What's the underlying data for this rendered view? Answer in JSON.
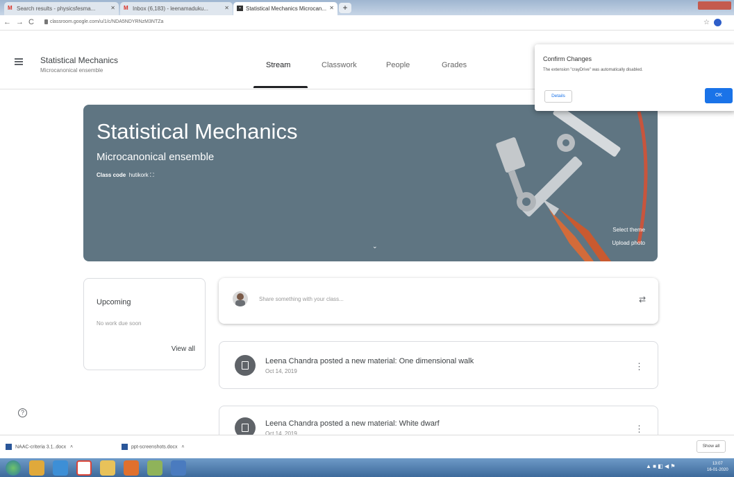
{
  "browser": {
    "tabs": [
      {
        "label": "Search results - physicsfesma...",
        "icon": "gmail-icon"
      },
      {
        "label": "Inbox (6,183) - leenamaduku...",
        "icon": "gmail-icon"
      },
      {
        "label": "Statistical Mechanics Microcan...",
        "icon": "classroom-icon"
      }
    ],
    "new_tab": "+",
    "url": "classroom.google.com/u/1/c/NDA5NDYRNzM3NTZa"
  },
  "header": {
    "class_title": "Statistical Mechanics",
    "class_subtitle": "Microcanonical ensemble",
    "tabs": [
      "Stream",
      "Classwork",
      "People",
      "Grades"
    ]
  },
  "popup": {
    "title": "Confirm Changes",
    "message": "The extension \"crayDrive\" was automatically disabled.",
    "details_label": "Details",
    "ok_label": "OK"
  },
  "banner": {
    "title": "Statistical Mechanics",
    "subtitle": "Microcanonical ensemble",
    "class_code_label": "Class code",
    "class_code": "hutikork",
    "select_theme": "Select theme",
    "upload_photo": "Upload photo",
    "color": "#5f7582"
  },
  "upcoming": {
    "title": "Upcoming",
    "empty_text": "No work due soon",
    "view_all": "View all"
  },
  "share": {
    "placeholder": "Share something with your class..."
  },
  "posts": [
    {
      "text": "Leena Chandra posted a new material: One dimensional walk",
      "date": "Oct 14, 2019"
    },
    {
      "text": "Leena Chandra posted a new material: White dwarf",
      "date": "Oct 14, 2019"
    }
  ],
  "downloads": {
    "items": [
      "NAAC-criteria 3.1..docx",
      "ppt-screenshots.docx"
    ],
    "show_all": "Show all"
  },
  "taskbar": {
    "time": "13:07",
    "date": "16-01-2020"
  }
}
